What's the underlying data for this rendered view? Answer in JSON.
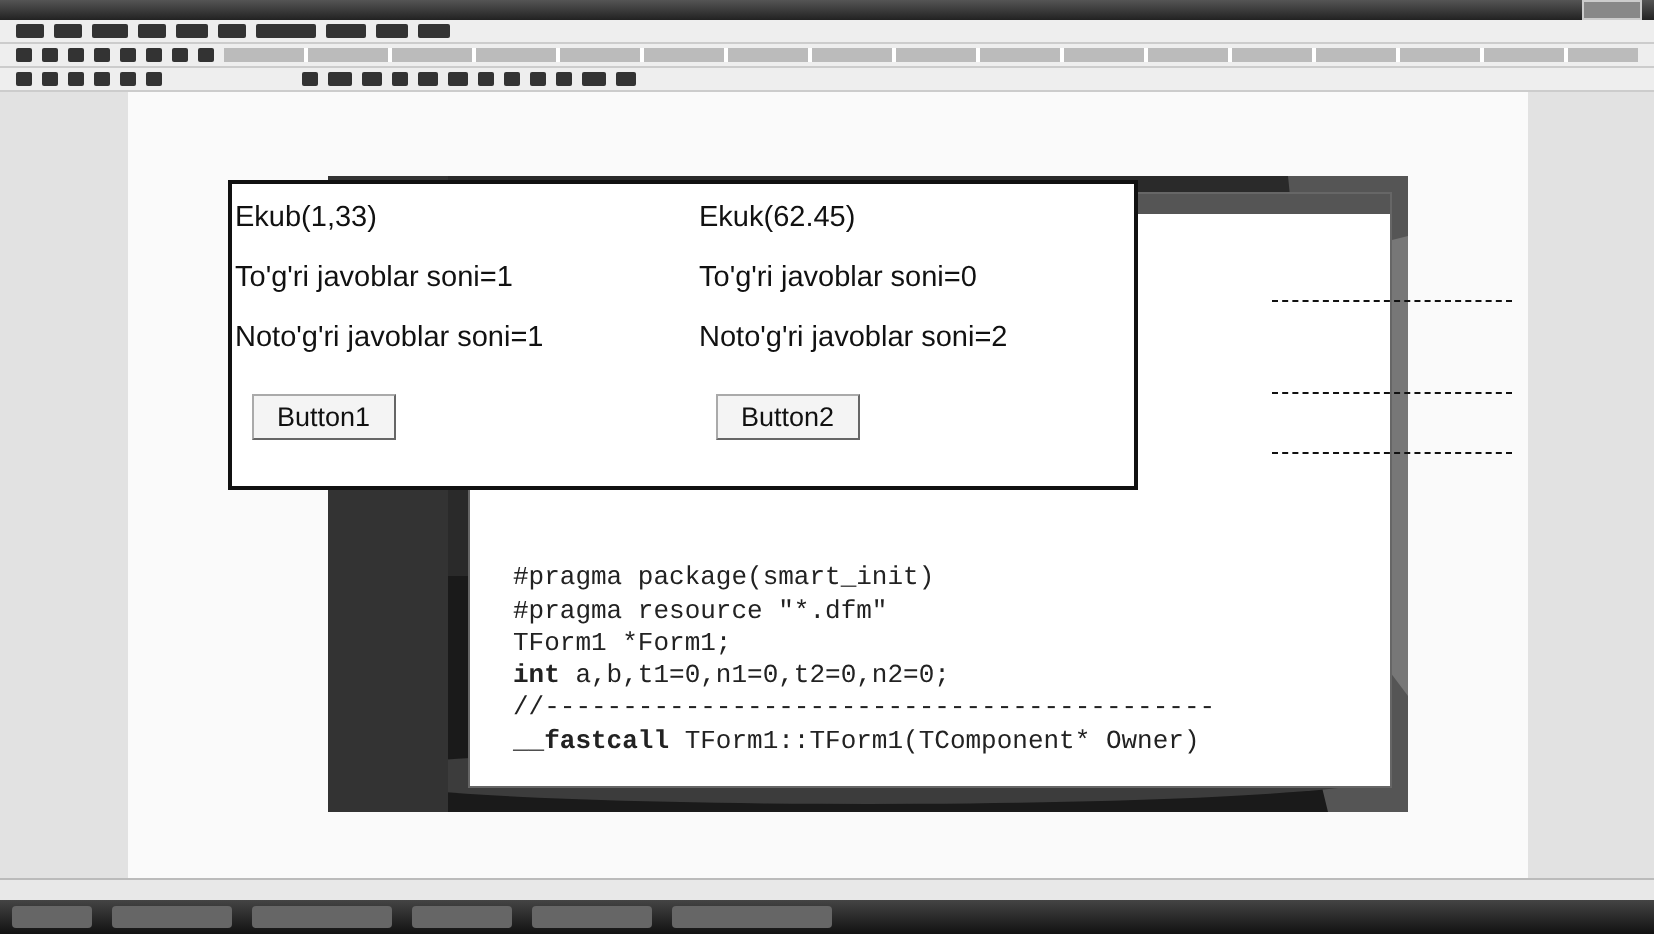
{
  "form": {
    "rows": [
      {
        "left": "Ekub(1,33)",
        "right": "Ekuk(62.45)"
      },
      {
        "left": "To'g'ri javoblar soni=1",
        "right": "To'g'ri javoblar soni=0"
      },
      {
        "left": "Noto'g'ri javoblar soni=1",
        "right": "Noto'g'ri javoblar soni=2"
      }
    ],
    "buttons": [
      "Button1",
      "Button2"
    ]
  },
  "editor": {
    "lines": [
      "#pragma package(smart_init)",
      "#pragma resource \"*.dfm\"",
      "TForm1 *Form1;",
      "**int** a,b,t1=0,n1=0,t2=0,n2=0;",
      "//-------------------------------------------",
      "**__fastcall** TForm1::TForm1(TComponent* Owner)"
    ]
  }
}
